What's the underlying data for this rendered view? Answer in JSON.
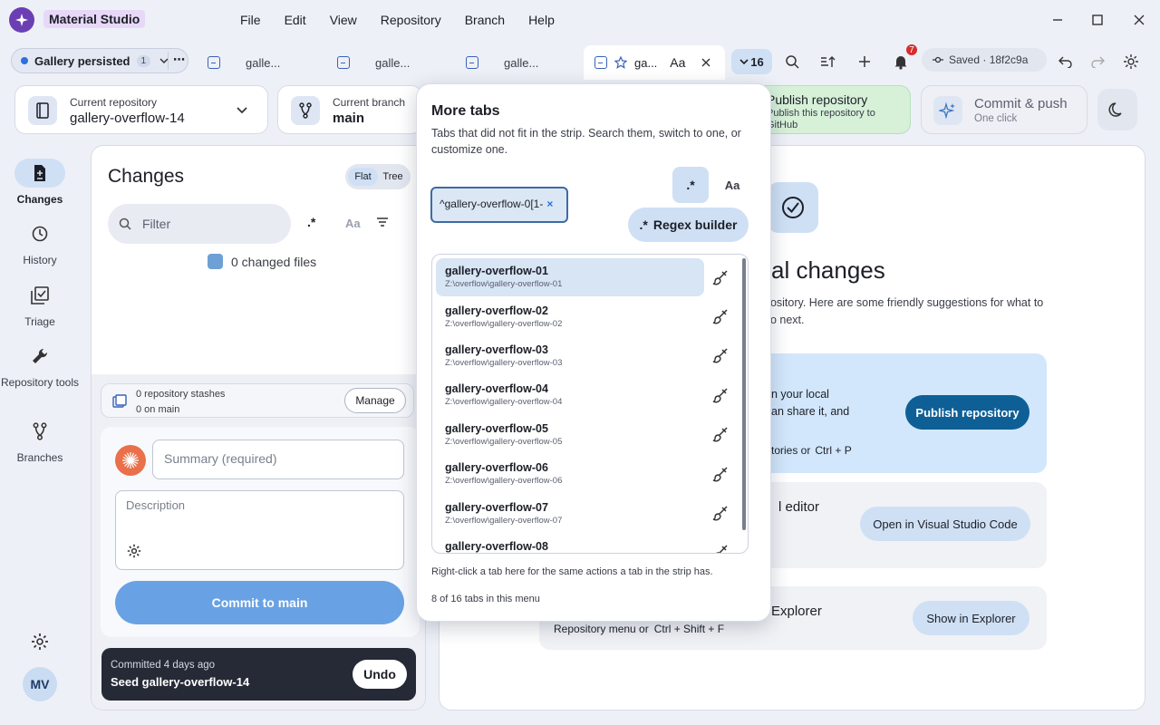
{
  "app": {
    "title": "Material Studio"
  },
  "menu": [
    "File",
    "Edit",
    "View",
    "Repository",
    "Branch",
    "Help"
  ],
  "workspace": {
    "name": "Gallery persisted",
    "count": "1"
  },
  "tabs": [
    {
      "label": "galle..."
    },
    {
      "label": "galle..."
    },
    {
      "label": "galle..."
    }
  ],
  "active_tab": {
    "label": "ga...",
    "case_label": "Aa"
  },
  "overflow": {
    "count": "16"
  },
  "notifications": {
    "count": "7"
  },
  "saved": {
    "label": "Saved · 18f2c9a"
  },
  "repo": {
    "label": "Current repository",
    "value": "gallery-overflow-14"
  },
  "branch": {
    "label": "Current branch",
    "value": "main"
  },
  "publish_card": {
    "title": "Publish repository",
    "subtitle": "Publish this repository to GitHub"
  },
  "commit_push": {
    "title": "Commit & push",
    "subtitle": "One click"
  },
  "rail": [
    {
      "label": "Changes"
    },
    {
      "label": "History"
    },
    {
      "label": "Triage"
    },
    {
      "label": "Repository tools"
    },
    {
      "label": "Branches"
    }
  ],
  "avatar": "MV",
  "changes": {
    "title": "Changes",
    "view_flat": "Flat",
    "view_tree": "Tree",
    "filter_placeholder": "Filter",
    "regex": ".*",
    "case": "Aa",
    "changed_files": "0 changed files",
    "stash_line1": "0 repository stashes",
    "stash_line2": "0 on main",
    "manage": "Manage",
    "summary_placeholder": "Summary (required)",
    "description_placeholder": "Description",
    "commit_button": "Commit to main"
  },
  "toast": {
    "line1": "Committed 4 days ago",
    "line2": "Seed gallery-overflow-14",
    "action": "Undo"
  },
  "main": {
    "title_partial": "al changes",
    "subtitle": "pository. Here are some friendly suggestions for what to do next.",
    "sug1_text_a": "n your local",
    "sug1_text_b": "an share it, and",
    "sug1_text_c": "tories or",
    "sug1_shortcut": "Ctrl + P",
    "sug1_button": "Publish repository",
    "sug2_title": "l editor",
    "sug2_button": "Open in Visual Studio Code",
    "sug3_title": "Explorer",
    "sug3_sub": "Repository menu or",
    "sug3_shortcut": "Ctrl + Shift + F",
    "sug3_button": "Show in Explorer"
  },
  "popover": {
    "title": "More tabs",
    "description": "Tabs that did not fit in the strip. Search them, switch to one, or customize one.",
    "search_value": "^gallery-overflow-0[1-",
    "regex_label": ".*",
    "case_label": "Aa",
    "regex_builder": "Regex builder",
    "items": [
      {
        "name": "gallery-overflow-01",
        "path": "Z:\\overflow\\gallery-overflow-01"
      },
      {
        "name": "gallery-overflow-02",
        "path": "Z:\\overflow\\gallery-overflow-02"
      },
      {
        "name": "gallery-overflow-03",
        "path": "Z:\\overflow\\gallery-overflow-03"
      },
      {
        "name": "gallery-overflow-04",
        "path": "Z:\\overflow\\gallery-overflow-04"
      },
      {
        "name": "gallery-overflow-05",
        "path": "Z:\\overflow\\gallery-overflow-05"
      },
      {
        "name": "gallery-overflow-06",
        "path": "Z:\\overflow\\gallery-overflow-06"
      },
      {
        "name": "gallery-overflow-07",
        "path": "Z:\\overflow\\gallery-overflow-07"
      },
      {
        "name": "gallery-overflow-08",
        "path": ""
      }
    ],
    "footer_hint": "Right-click a tab here for the same actions a tab in the strip has.",
    "footer_count": "8 of 16 tabs in this menu"
  },
  "colors": {
    "accent": "#2e6fd8",
    "publish_button": "#0e5f96",
    "commit_button": "#69a2e4",
    "brand": "#6b3fb3"
  }
}
